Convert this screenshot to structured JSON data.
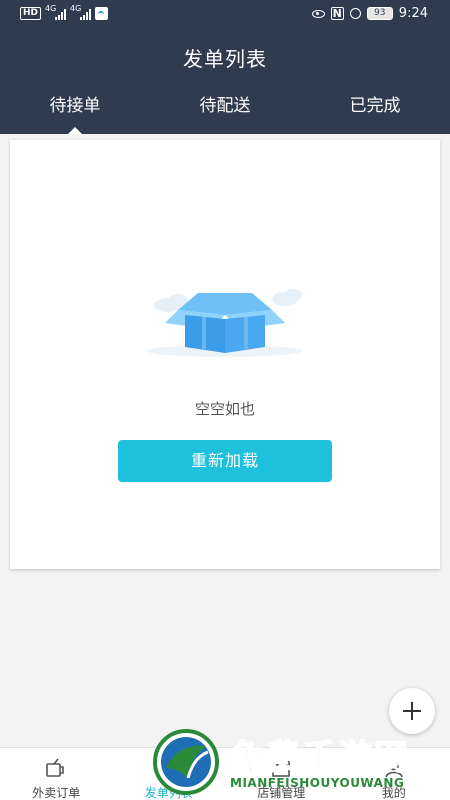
{
  "status_bar": {
    "hd_label": "HD",
    "network_1": "4G",
    "network_2": "4G",
    "nfc_label": "N",
    "battery": "93",
    "time": "9:24"
  },
  "header": {
    "title": "发单列表",
    "tabs": [
      {
        "label": "待接单",
        "active": true
      },
      {
        "label": "待配送",
        "active": false
      },
      {
        "label": "已完成",
        "active": false
      }
    ]
  },
  "content": {
    "empty_text": "空空如也",
    "reload_label": "重新加载"
  },
  "fab": {
    "icon": "plus-icon"
  },
  "bottom_nav": {
    "items": [
      {
        "label": "外卖订单",
        "icon": "takeout-icon",
        "active": false
      },
      {
        "label": "发单列表",
        "icon": "send-list-icon",
        "active": true
      },
      {
        "label": "店铺管理",
        "icon": "store-icon",
        "active": false
      },
      {
        "label": "我的",
        "icon": "profile-icon",
        "active": false
      }
    ]
  },
  "watermark": {
    "title": "免费手游网",
    "subtitle": "MIANFEISHOUYOUWANG"
  },
  "colors": {
    "header_bg": "#2f3b4f",
    "accent": "#1ec0dc",
    "active_nav": "#1ab0cc",
    "box_blue": "#4aa8f0"
  }
}
